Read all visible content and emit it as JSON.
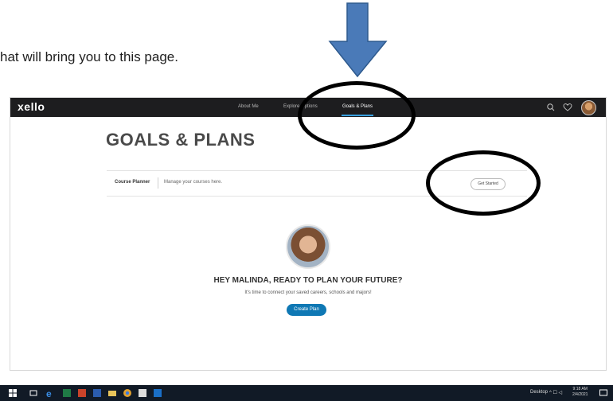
{
  "document": {
    "instruction_text": "hat will bring you to this page."
  },
  "app": {
    "logo": "xello",
    "nav": {
      "about_me": "About Me",
      "explore_options": "Explore Options",
      "goals_plans": "Goals & Plans"
    },
    "page_title": "GOALS & PLANS",
    "course_planner": {
      "title": "Course Planner",
      "description": "Manage your courses here.",
      "button": "Get Started"
    },
    "greeting": "HEY MALINDA, READY TO PLAN YOUR FUTURE?",
    "subtext": "It's time to connect your saved careers, schools and majors!",
    "create_button": "Create Plan"
  },
  "taskbar": {
    "desktop_label": "Desktop",
    "time": "9:18 AM",
    "date": "2/4/2021"
  },
  "colors": {
    "navbar": "#1d1d1f",
    "accent": "#0f78b4",
    "arrow": "#4a7ab8",
    "annotation": "#000000"
  },
  "icons": [
    "search-icon",
    "heart-icon",
    "windows-start-icon",
    "edge-icon",
    "excel-icon",
    "powerpoint-icon",
    "word-icon",
    "file-explorer-icon",
    "chrome-icon",
    "outlook-icon"
  ]
}
